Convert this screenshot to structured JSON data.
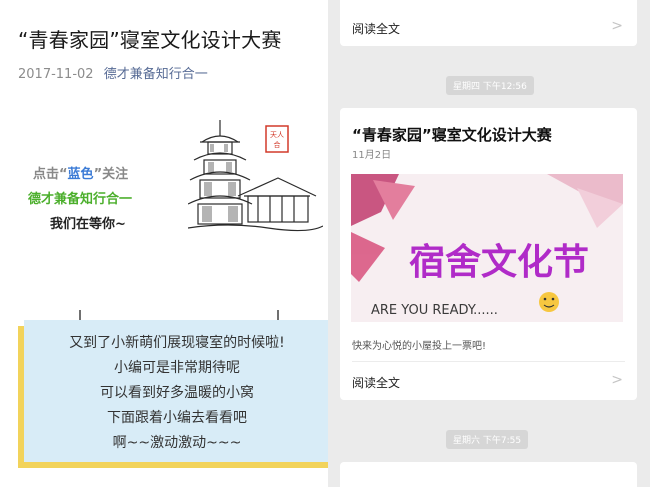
{
  "article": {
    "title": "“青春家园”寝室文化设计大赛",
    "date": "2017-11-02",
    "author": "德才兼备知行合一"
  },
  "promo": {
    "line1_prefix": "点击“",
    "line1_highlight": "蓝色",
    "line1_suffix": "”关注",
    "line2": "德才兼备知行合一",
    "line3": "我们在等你~"
  },
  "highlight_box": {
    "lines": [
      "又到了小新萌们展现寝室的时候啦!",
      "小编可是非常期待呢",
      "可以看到好多温暖的小窝",
      "下面跟着小编去看看吧",
      "啊~~激动激动~~~"
    ]
  },
  "chat": {
    "card1": {
      "read_all": "阅读全文"
    },
    "time1": "星期四 下午12:56",
    "card2": {
      "title": "“青春家园”寝室文化设计大赛",
      "date": "11月2日",
      "cover_text": "宿舍文化节",
      "cover_subtext": "ARE YOU READY......",
      "description": "快来为心悦的小屋投上一票吧!",
      "read_all": "阅读全文"
    },
    "time2": "星期六 下午7:55"
  },
  "colors": {
    "link_blue": "#576b95",
    "promo_blue": "#3b7bd6",
    "promo_green": "#4caf2c",
    "box_bg": "#d8ecf7",
    "box_shadow": "#f2d35b",
    "cover_purple": "#b02bc8"
  },
  "icons": [
    "chevron-right-icon",
    "pagoda-illustration",
    "seal-stamp-icon",
    "smiley-icon",
    "pin-icon"
  ]
}
